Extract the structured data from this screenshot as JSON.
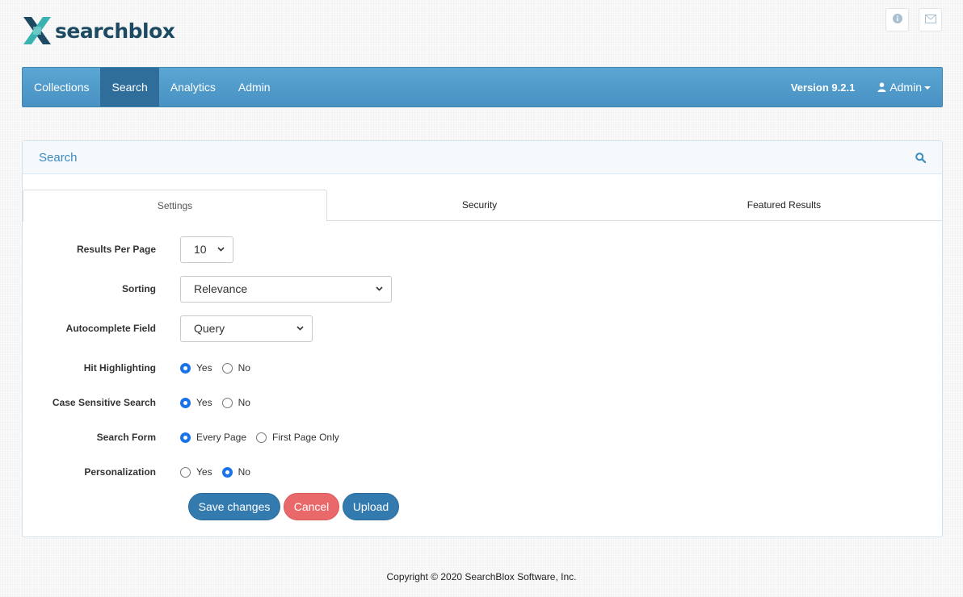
{
  "brand": {
    "name": "searchblox"
  },
  "top_icons": [
    "info-icon",
    "envelope-icon"
  ],
  "nav": {
    "items": [
      {
        "label": "Collections",
        "active": false
      },
      {
        "label": "Search",
        "active": true
      },
      {
        "label": "Analytics",
        "active": false
      },
      {
        "label": "Admin",
        "active": false
      }
    ],
    "version": "Version 9.2.1",
    "user_label": "Admin"
  },
  "panel": {
    "title": "Search",
    "tabs": [
      {
        "label": "Settings",
        "active": true
      },
      {
        "label": "Security",
        "active": false
      },
      {
        "label": "Featured Results",
        "active": false
      }
    ]
  },
  "form": {
    "results_per_page": {
      "label": "Results Per Page",
      "value": "10"
    },
    "sorting": {
      "label": "Sorting",
      "value": "Relevance"
    },
    "autocomplete_field": {
      "label": "Autocomplete Field",
      "value": "Query"
    },
    "hit_highlighting": {
      "label": "Hit Highlighting",
      "options": [
        "Yes",
        "No"
      ],
      "selected": "Yes"
    },
    "case_sensitive_search": {
      "label": "Case Sensitive Search",
      "options": [
        "Yes",
        "No"
      ],
      "selected": "Yes"
    },
    "search_form": {
      "label": "Search Form",
      "options": [
        "Every Page",
        "First Page Only"
      ],
      "selected": "Every Page"
    },
    "personalization": {
      "label": "Personalization",
      "options": [
        "Yes",
        "No"
      ],
      "selected": "No"
    }
  },
  "buttons": {
    "save": "Save changes",
    "cancel": "Cancel",
    "upload": "Upload"
  },
  "footer": {
    "copyright": "Copyright © 2020 SearchBlox Software, Inc."
  },
  "colors": {
    "navbar": "#5ba6d3",
    "nav_active": "#2f6e9a",
    "primary_button": "#337aae",
    "danger_button": "#e9686a",
    "radio_checked": "#1a73e8",
    "brand_text": "#1d4a63"
  }
}
